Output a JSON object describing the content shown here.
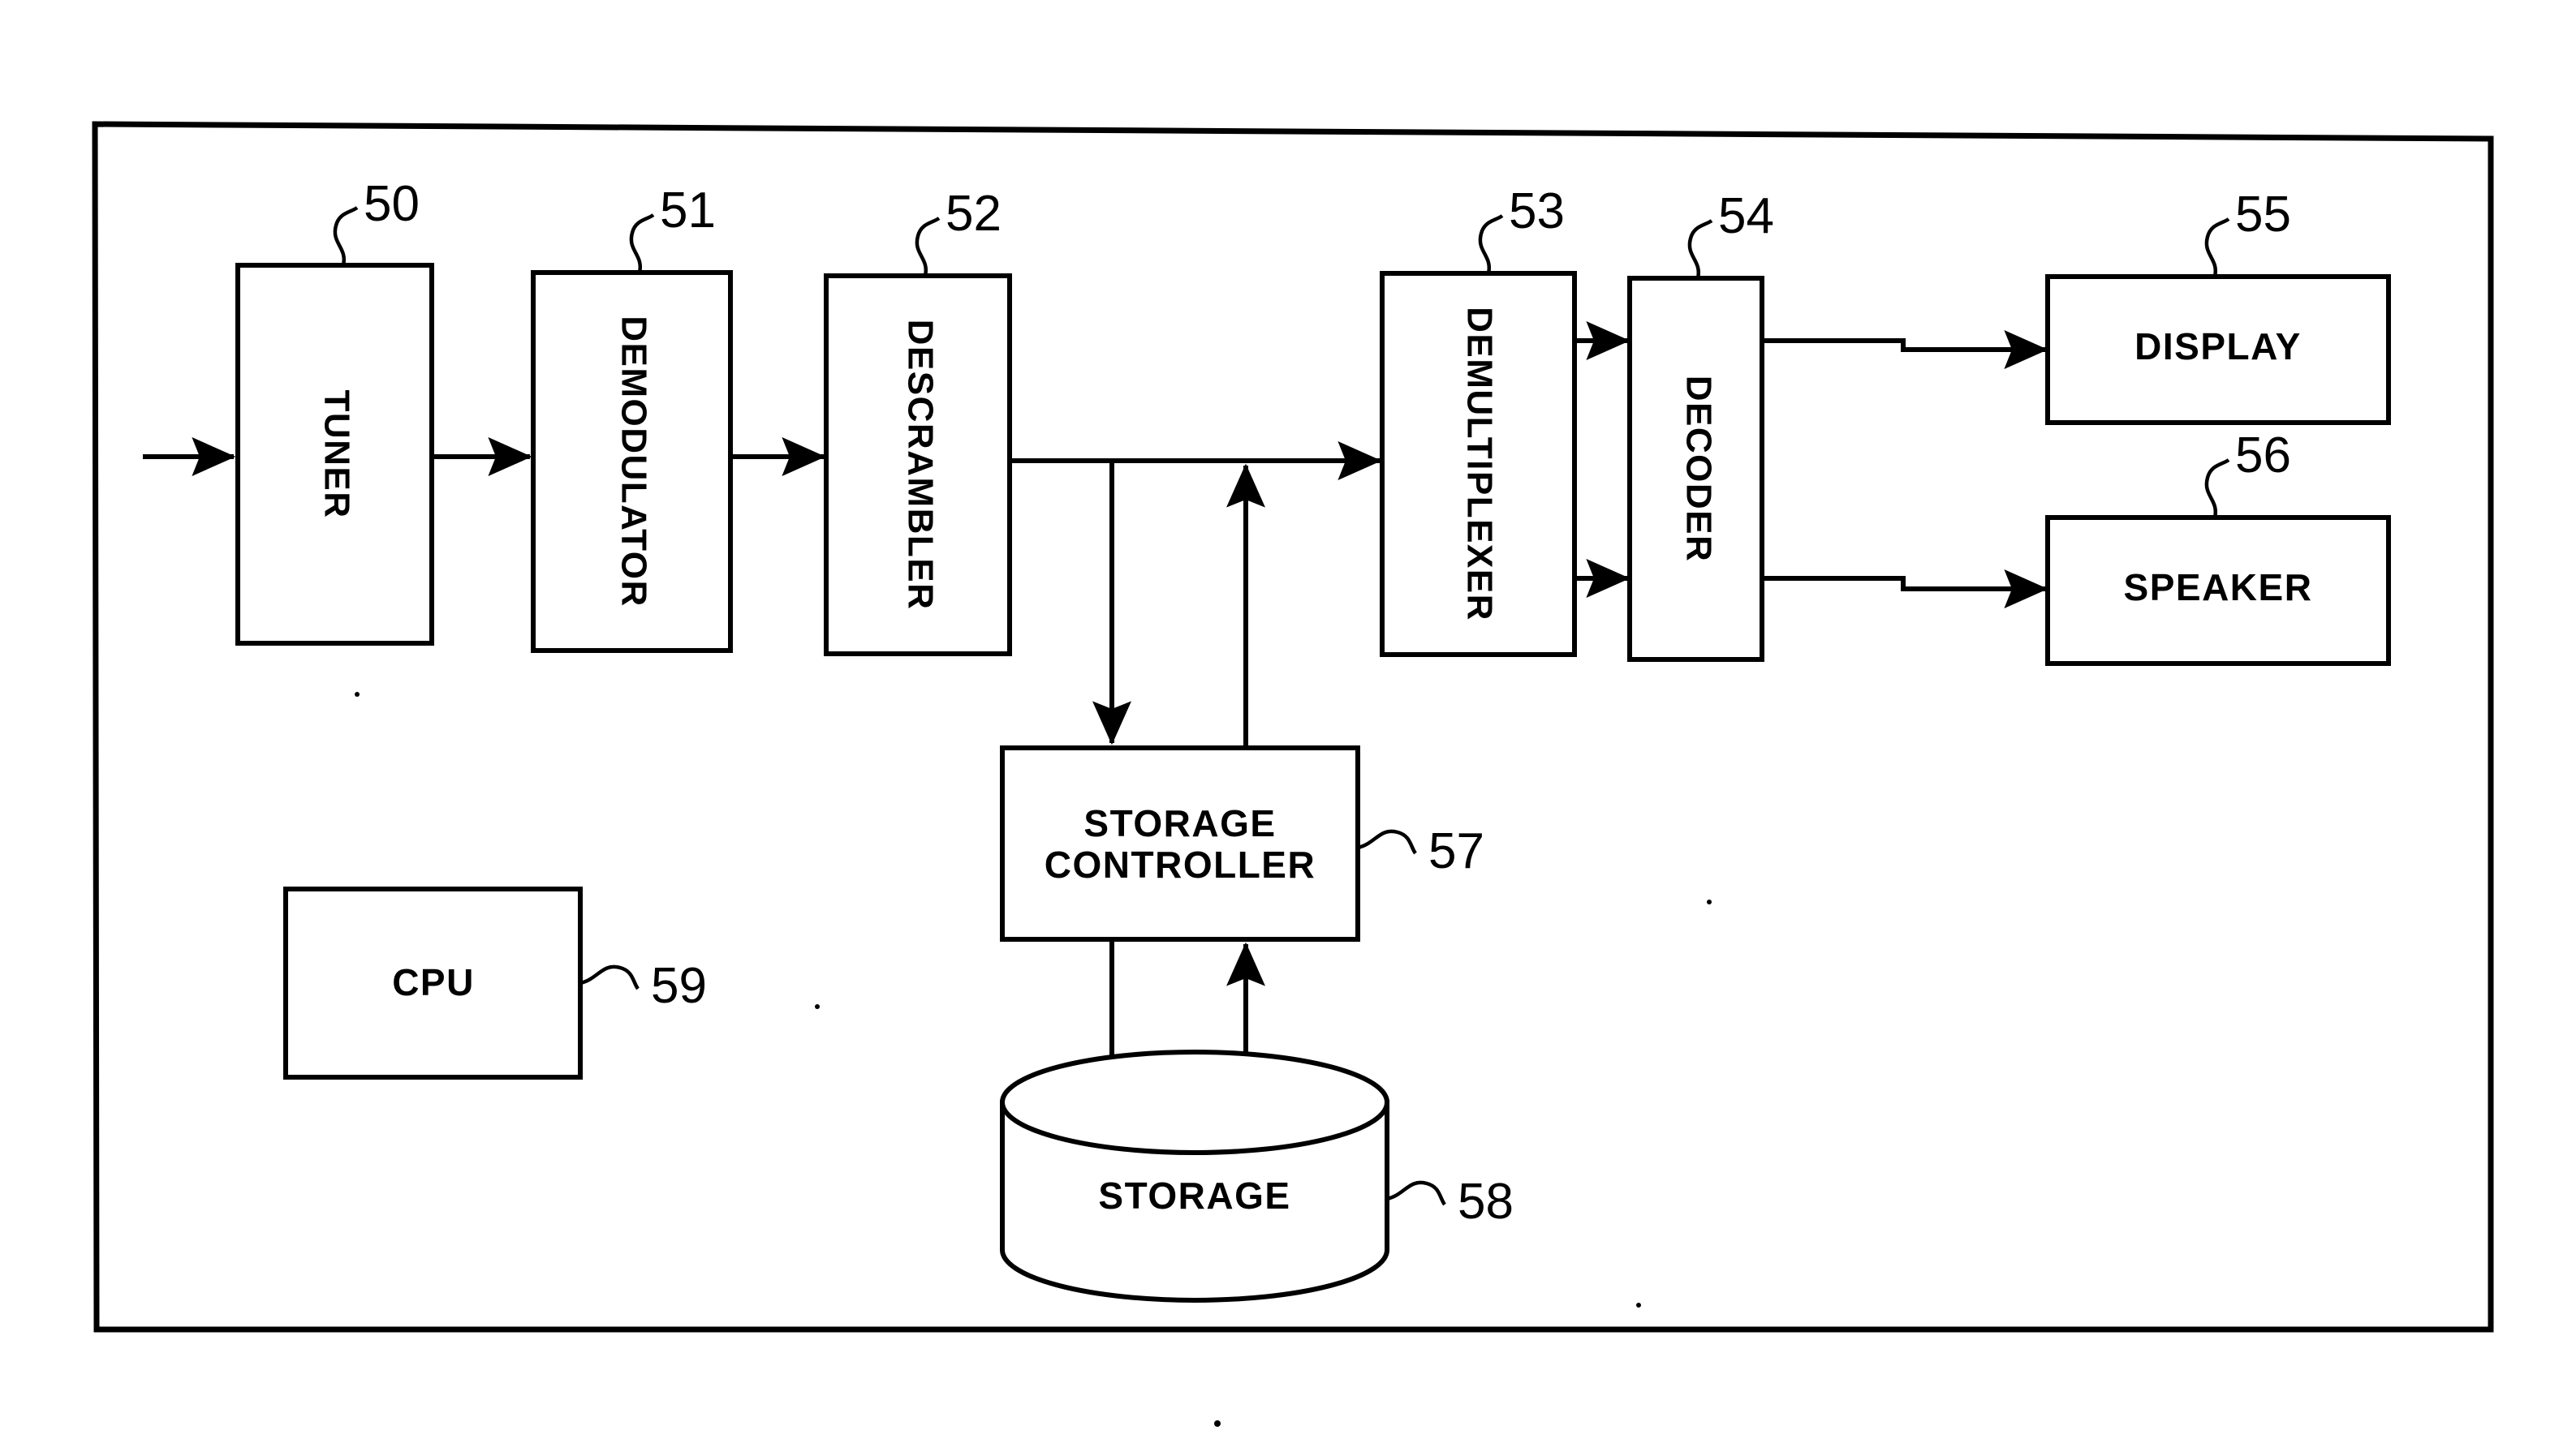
{
  "figure": {
    "kind": "patent-block-diagram",
    "title": "",
    "background_color": "#ffffff",
    "line_color": "#000000"
  },
  "blocks": [
    {
      "id": "tuner",
      "label": "TUNER",
      "ref": "50",
      "orientation": "vertical",
      "shape": "rect"
    },
    {
      "id": "demodulator",
      "label": "DEMODULATOR",
      "ref": "51",
      "orientation": "vertical",
      "shape": "rect"
    },
    {
      "id": "descrambler",
      "label": "DESCRAMBLER",
      "ref": "52",
      "orientation": "vertical",
      "shape": "rect"
    },
    {
      "id": "demultiplexer",
      "label": "DEMULTIPLEXER",
      "ref": "53",
      "orientation": "vertical",
      "shape": "rect"
    },
    {
      "id": "decoder",
      "label": "DECODER",
      "ref": "54",
      "orientation": "vertical",
      "shape": "rect"
    },
    {
      "id": "display",
      "label": "DISPLAY",
      "ref": "55",
      "orientation": "horizontal",
      "shape": "rect"
    },
    {
      "id": "speaker",
      "label": "SPEAKER",
      "ref": "56",
      "orientation": "horizontal",
      "shape": "rect"
    },
    {
      "id": "storage-controller",
      "label": "STORAGE CONTROLLER",
      "label_line1": "STORAGE",
      "label_line2": "CONTROLLER",
      "ref": "57",
      "orientation": "horizontal",
      "shape": "rect"
    },
    {
      "id": "storage",
      "label": "STORAGE",
      "ref": "58",
      "orientation": "horizontal",
      "shape": "cylinder"
    },
    {
      "id": "cpu",
      "label": "CPU",
      "ref": "59",
      "orientation": "horizontal",
      "shape": "rect"
    }
  ],
  "labels": {
    "tuner": "TUNER",
    "demodulator": "DEMODULATOR",
    "descrambler": "DESCRAMBLER",
    "demultiplexer": "DEMULTIPLEXER",
    "decoder": "DECODER",
    "display": "DISPLAY",
    "speaker": "SPEAKER",
    "storage_controller_line1": "STORAGE",
    "storage_controller_line2": "CONTROLLER",
    "storage": "STORAGE",
    "cpu": "CPU"
  },
  "reference_numerals": {
    "tuner": "50",
    "demodulator": "51",
    "descrambler": "52",
    "demultiplexer": "53",
    "decoder": "54",
    "display": "55",
    "speaker": "56",
    "storage_controller": "57",
    "storage": "58",
    "cpu": "59"
  },
  "connections": [
    {
      "id": "input-to-tuner",
      "from": "signal-input",
      "to": "tuner",
      "arrow": "end",
      "direction": "right"
    },
    {
      "id": "tuner-to-demodulator",
      "from": "tuner",
      "to": "demodulator",
      "arrow": "end",
      "direction": "right"
    },
    {
      "id": "demodulator-to-descrambler",
      "from": "demodulator",
      "to": "descrambler",
      "arrow": "end",
      "direction": "right"
    },
    {
      "id": "descrambler-to-demultiplexer",
      "from": "descrambler",
      "to": "demultiplexer",
      "arrow": "end",
      "direction": "right"
    },
    {
      "id": "bus-to-storage-controller",
      "from": "descrambler-bus",
      "to": "storage-controller",
      "arrow": "end",
      "direction": "down"
    },
    {
      "id": "storage-controller-to-bus",
      "from": "storage-controller",
      "to": "descrambler-bus",
      "arrow": "end",
      "direction": "up"
    },
    {
      "id": "demultiplexer-to-decoder-video",
      "from": "demultiplexer",
      "to": "decoder",
      "arrow": "end",
      "direction": "right"
    },
    {
      "id": "demultiplexer-to-decoder-audio",
      "from": "demultiplexer",
      "to": "decoder",
      "arrow": "end",
      "direction": "right"
    },
    {
      "id": "decoder-to-display",
      "from": "decoder",
      "to": "display",
      "arrow": "end",
      "direction": "right"
    },
    {
      "id": "decoder-to-speaker",
      "from": "decoder",
      "to": "speaker",
      "arrow": "end",
      "direction": "right"
    },
    {
      "id": "storage-controller-to-storage",
      "from": "storage-controller",
      "to": "storage",
      "arrow": "end",
      "direction": "down"
    },
    {
      "id": "storage-to-storage-controller",
      "from": "storage",
      "to": "storage-controller",
      "arrow": "end",
      "direction": "up"
    }
  ]
}
